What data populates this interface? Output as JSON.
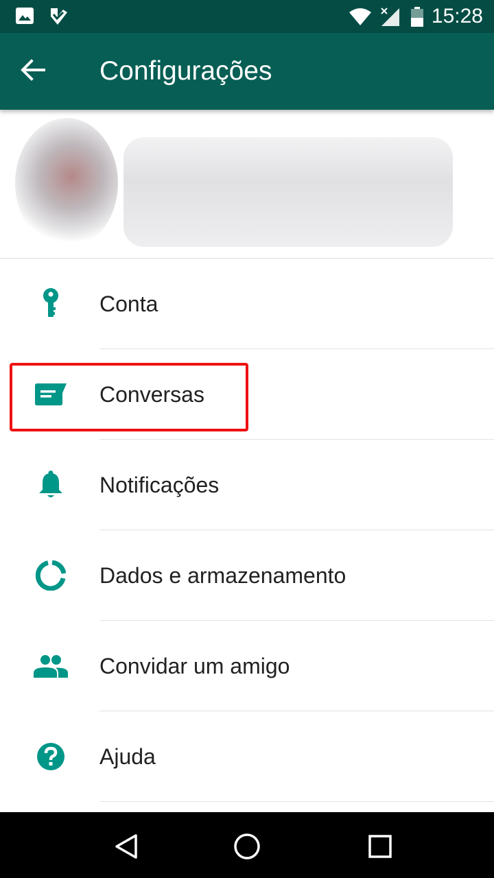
{
  "status_bar": {
    "time": "15:28",
    "icons": [
      "image-icon",
      "check-app-icon",
      "wifi-icon",
      "signal-icon",
      "battery-icon"
    ]
  },
  "app_bar": {
    "title": "Configurações",
    "back_icon": "arrow-back-icon"
  },
  "colors": {
    "status_bar": "#054d44",
    "app_bar": "#075e54",
    "accent_icon": "#009688",
    "highlight": "#ee1111"
  },
  "settings": {
    "items": [
      {
        "label": "Conta",
        "icon": "key-icon"
      },
      {
        "label": "Conversas",
        "icon": "chat-icon"
      },
      {
        "label": "Notificações",
        "icon": "bell-icon"
      },
      {
        "label": "Dados e armazenamento",
        "icon": "data-usage-icon"
      },
      {
        "label": "Convidar um amigo",
        "icon": "people-icon"
      },
      {
        "label": "Ajuda",
        "icon": "help-icon"
      }
    ]
  },
  "nav_bar": {
    "buttons": [
      "back-triangle-icon",
      "home-circle-icon",
      "recents-square-icon"
    ]
  }
}
